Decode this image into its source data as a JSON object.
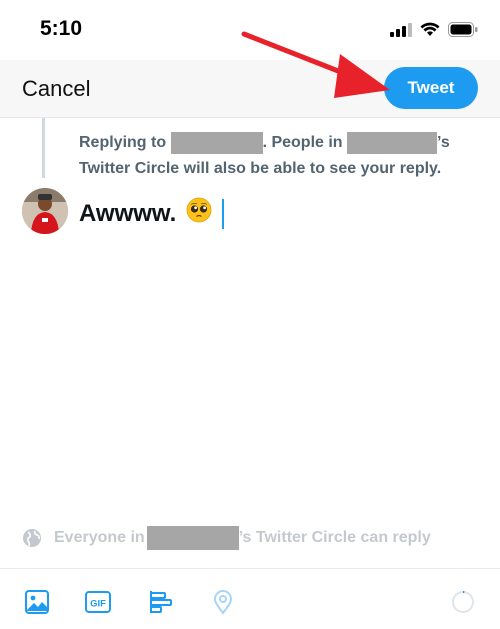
{
  "status": {
    "time": "5:10"
  },
  "nav": {
    "cancel_label": "Cancel",
    "tweet_label": "Tweet"
  },
  "reply": {
    "prefix": "Replying to",
    "middle": ". People in",
    "suffix": "’s Twitter Circle will also be able to see your reply."
  },
  "compose": {
    "text": "Awwww.",
    "emoji": "🥺"
  },
  "reply_setting": {
    "prefix": "Everyone in",
    "suffix": "’s Twitter Circle can reply"
  },
  "toolbar": {
    "items": [
      "image-icon",
      "gif-icon",
      "poll-icon",
      "location-icon"
    ]
  },
  "colors": {
    "accent": "#1d9bf0",
    "arrow": "#e8222b",
    "muted": "#536471"
  }
}
